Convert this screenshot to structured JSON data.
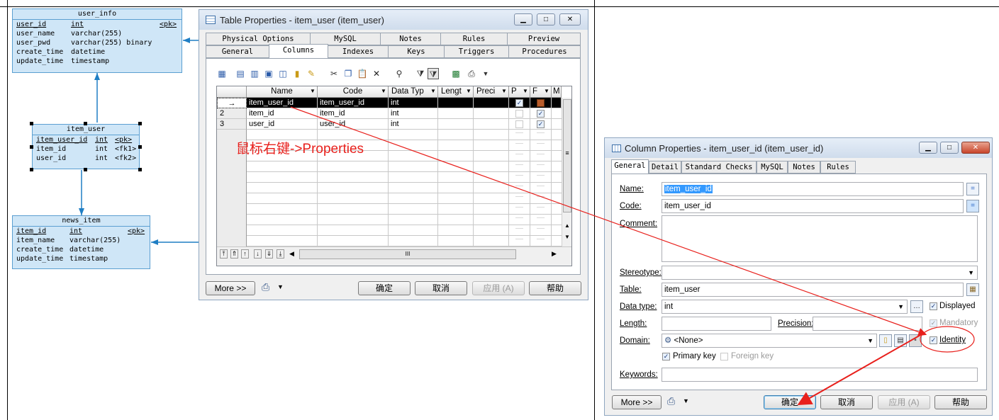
{
  "diagram": {
    "user_info": {
      "title": "user_info",
      "rows": [
        {
          "name": "user_id",
          "type": "int",
          "key": "<pk>",
          "pk": true
        },
        {
          "name": "user_name",
          "type": "varchar(255)",
          "key": ""
        },
        {
          "name": "user_pwd",
          "type": "varchar(255) binary",
          "key": ""
        },
        {
          "name": "create_time",
          "type": "datetime",
          "key": ""
        },
        {
          "name": "update_time",
          "type": "timestamp",
          "key": ""
        }
      ]
    },
    "item_user": {
      "title": "item_user",
      "rows": [
        {
          "name": "item_user_id",
          "type": "int",
          "key": "<pk>",
          "pk": true
        },
        {
          "name": "item_id",
          "type": "int",
          "key": "<fk1>"
        },
        {
          "name": "user_id",
          "type": "int",
          "key": "<fk2>"
        }
      ]
    },
    "news_item": {
      "title": "news_item",
      "rows": [
        {
          "name": "item_id",
          "type": "int",
          "key": "<pk>",
          "pk": true
        },
        {
          "name": "item_name",
          "type": "varchar(255)",
          "key": ""
        },
        {
          "name": "create_time",
          "type": "datetime",
          "key": ""
        },
        {
          "name": "update_time",
          "type": "timestamp",
          "key": ""
        }
      ]
    }
  },
  "table_props": {
    "title": "Table Properties - item_user (item_user)",
    "tabs_row1": [
      "Physical Options",
      "MySQL",
      "Notes",
      "Rules",
      "Preview"
    ],
    "tabs_row2": [
      "General",
      "Columns",
      "Indexes",
      "Keys",
      "Triggers",
      "Procedures"
    ],
    "active_tab": "Columns",
    "grid_headers": [
      "Name",
      "Code",
      "Data Typ",
      "Lengt",
      "Preci",
      "P",
      "F",
      "M"
    ],
    "rows": [
      {
        "num": "→",
        "name": "item_user_id",
        "code": "item_user_id",
        "type": "int",
        "p": true,
        "f": false,
        "selected": true
      },
      {
        "num": "2",
        "name": "item_id",
        "code": "item_id",
        "type": "int",
        "p": false,
        "f": true
      },
      {
        "num": "3",
        "name": "user_id",
        "code": "user_id",
        "type": "int",
        "p": false,
        "f": true
      }
    ],
    "annotation": "鼠标右键->Properties",
    "more_label": "More >>",
    "ok_label": "确定",
    "cancel_label": "取消",
    "apply_label": "应用 (A)",
    "help_label": "帮助",
    "hscroll_text": "III"
  },
  "col_props": {
    "title": "Column Properties - item_user_id (item_user_id)",
    "tabs": [
      "General",
      "Detail",
      "Standard Checks",
      "MySQL",
      "Notes",
      "Rules"
    ],
    "active_tab": "General",
    "name_label": "Name:",
    "name_value": "item_user_id",
    "code_label": "Code:",
    "code_value": "item_user_id",
    "comment_label": "Comment:",
    "stereotype_label": "Stereotype:",
    "table_label": "Table:",
    "table_value": "item_user",
    "datatype_label": "Data type:",
    "datatype_value": "int",
    "displayed_label": "Displayed",
    "length_label": "Length:",
    "precision_label": "Precision:",
    "mandatory_label": "Mandatory",
    "domain_label": "Domain:",
    "domain_value": "<None>",
    "identity_label": "Identity",
    "primary_key_label": "Primary key",
    "foreign_key_label": "Foreign key",
    "keywords_label": "Keywords:",
    "more_label": "More >>",
    "ok_label": "确定",
    "cancel_label": "取消",
    "apply_label": "应用 (A)",
    "help_label": "帮助",
    "equals_label": "="
  },
  "colors": {
    "annotation": "#e8201c",
    "entity_fill": "#cfe6f7",
    "entity_border": "#5b9fd1",
    "selection": "#3399ff"
  }
}
